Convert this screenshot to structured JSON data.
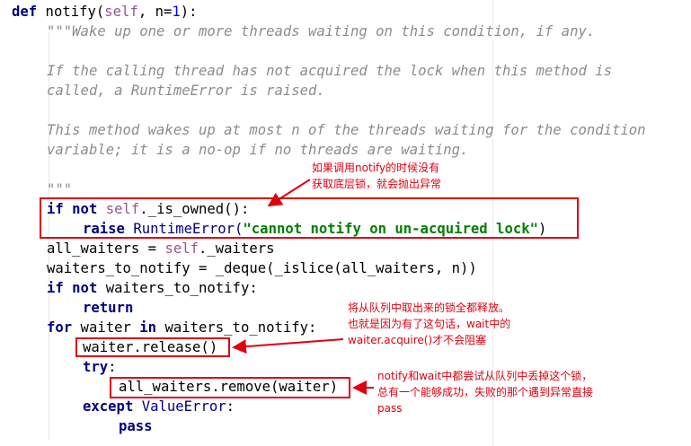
{
  "code": {
    "def_keyword": "def",
    "func_sig_rest": " notify(",
    "self_kw": "self",
    "params_rest": ", n=",
    "default_num": "1",
    "sig_end": "):",
    "doc_1": "\"\"\"Wake up one or more threads waiting on this condition, if any.",
    "doc_2": "If the calling thread has not acquired the lock when this method is",
    "doc_3": "called, a RuntimeError is raised.",
    "doc_4": "This method wakes up at most n of the threads waiting for the condition",
    "doc_5": "variable; it is a no-op if no threads are waiting.",
    "doc_end": "\"\"\"",
    "if_kw": "if",
    "not_kw": "not",
    "owned_self": "self",
    "owned_rest": "._is_owned():",
    "raise_kw": "raise",
    "runtime_error": "RuntimeError(",
    "error_msg": "\"cannot notify on un-acquired lock\"",
    "raise_end": ")",
    "all_waiters_lhs": "all_waiters = ",
    "all_waiters_self": "self",
    "all_waiters_rhs": "._waiters",
    "waiters_to_notify_line": "waiters_to_notify = _deque(_islice(all_waiters, n))",
    "if2_kw": "if",
    "not2_kw": "not",
    "if2_rest": " waiters_to_notify:",
    "return_kw": "return",
    "for_kw": "for",
    "for_var": " waiter ",
    "in_kw": "in",
    "for_rest": " waiters_to_notify:",
    "release_line": "waiter.release()",
    "try_kw": "try",
    "try_colon": ":",
    "remove_line": "all_waiters.remove(waiter)",
    "except_kw": "except",
    "value_error": " ValueError",
    "except_colon": ":",
    "pass_kw": "pass"
  },
  "annotations": {
    "note_1": "如果调用notify的时候没有\n获取底层锁，就会抛出异常",
    "note_2": "将从队列中取出来的锁全都释放。\n也就是因为有了这句话，wait中的\nwaiter.acquire()才不会阻塞",
    "note_3": "notify和wait中都尝试从队列中丢掉这个锁，\n总有一个能够成功，失败的那个遇到异常直接\npass"
  },
  "colors": {
    "annotation_red": "#e0000f",
    "keyword": "#000080",
    "self": "#94558d",
    "string": "#008000",
    "docstring": "#8c8c8c",
    "number": "#0000ff"
  }
}
